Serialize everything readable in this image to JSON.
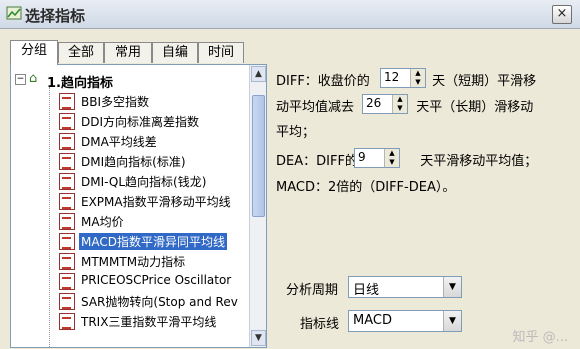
{
  "window": {
    "title": "选择指标",
    "close_label": "×"
  },
  "tabs": [
    "分组",
    "全部",
    "常用",
    "自编",
    "时间"
  ],
  "tree": {
    "root_label": "1.趋向指标",
    "items": [
      "BBI多空指数",
      "DDI方向标准离差指数",
      "DMA平均线差",
      "DMI趋向指标(标准)",
      "DMI-QL趋向指标(钱龙)",
      "EXPMA指数平滑移动平均线",
      "MA均价",
      "MACD指数平滑异同平均线",
      "MTMMTM动力指标",
      "PRICEOSCPrice Oscillator",
      "SAR抛物转向(Stop and Rev",
      "TRIX三重指数平滑平均线"
    ],
    "selected_index": 7
  },
  "description": {
    "diff_prefix": "DIFF：收盘价的",
    "diff_short_value": "12",
    "diff_mid": "天（短期）平滑移",
    "line2_prefix": "动平均值减去",
    "diff_long_value": "26",
    "line2_suffix": "天平（长期）滑移动",
    "line3": "平均；",
    "dea_prefix": "DEA：DIFF的",
    "dea_value": "9",
    "dea_suffix": "天平滑移动平均值；",
    "macd_line": "MACD：2倍的（DIFF-DEA）。"
  },
  "params": {
    "period_label": "分析周期",
    "period_value": "日线",
    "indicator_label": "指标线",
    "indicator_value": "MACD"
  },
  "watermark": "知乎 @..."
}
